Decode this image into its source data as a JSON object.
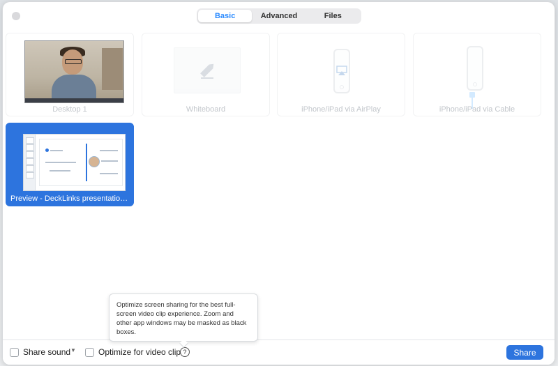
{
  "tabs": [
    {
      "label": "Basic",
      "active": true
    },
    {
      "label": "Advanced",
      "active": false
    },
    {
      "label": "Files",
      "active": false
    }
  ],
  "sources": [
    {
      "label": "Desktop 1",
      "icon": "desktop-icon"
    },
    {
      "label": "Whiteboard",
      "icon": "pencil-icon"
    },
    {
      "label": "iPhone/iPad via AirPlay",
      "icon": "airplay-icon"
    },
    {
      "label": "iPhone/iPad via Cable",
      "icon": "cable-icon"
    }
  ],
  "windows": [
    {
      "label": "Preview - DeckLinks presentation....",
      "selected": true
    }
  ],
  "bottom": {
    "share_sound_label": "Share sound",
    "optimize_label": "Optimize for video clip",
    "help_glyph": "?",
    "share_button_label": "Share"
  },
  "tooltip": {
    "text": "Optimize screen sharing for the best full-screen video clip experience. Zoom and other app windows may be masked as black boxes."
  },
  "colors": {
    "accent": "#2d74de",
    "tab_active_text": "#2d8cff"
  }
}
